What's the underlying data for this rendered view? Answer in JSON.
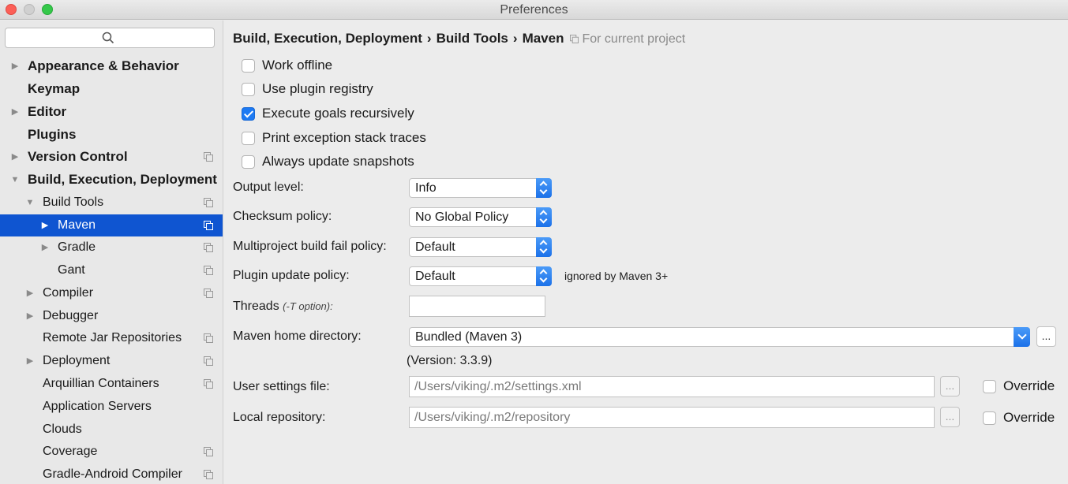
{
  "window": {
    "title": "Preferences"
  },
  "sidebar": {
    "search_placeholder": "",
    "items": [
      {
        "label": "Appearance & Behavior",
        "bold": true,
        "arrow": "right"
      },
      {
        "label": "Keymap",
        "bold": true,
        "arrow": ""
      },
      {
        "label": "Editor",
        "bold": true,
        "arrow": "right"
      },
      {
        "label": "Plugins",
        "bold": true,
        "arrow": ""
      },
      {
        "label": "Version Control",
        "bold": true,
        "arrow": "right"
      },
      {
        "label": "Build, Execution, Deployment",
        "bold": true,
        "arrow": "down"
      },
      {
        "label": "Build Tools",
        "bold": false,
        "arrow": "down"
      },
      {
        "label": "Maven",
        "bold": false,
        "arrow": "right",
        "selected": true
      },
      {
        "label": "Gradle",
        "bold": false,
        "arrow": "right"
      },
      {
        "label": "Gant",
        "bold": false,
        "arrow": ""
      },
      {
        "label": "Compiler",
        "bold": false,
        "arrow": "right"
      },
      {
        "label": "Debugger",
        "bold": false,
        "arrow": "right"
      },
      {
        "label": "Remote Jar Repositories",
        "bold": false,
        "arrow": ""
      },
      {
        "label": "Deployment",
        "bold": false,
        "arrow": "right"
      },
      {
        "label": "Arquillian Containers",
        "bold": false,
        "arrow": ""
      },
      {
        "label": "Application Servers",
        "bold": false,
        "arrow": ""
      },
      {
        "label": "Clouds",
        "bold": false,
        "arrow": ""
      },
      {
        "label": "Coverage",
        "bold": false,
        "arrow": ""
      },
      {
        "label": "Gradle-Android Compiler",
        "bold": false,
        "arrow": ""
      }
    ]
  },
  "breadcrumb": {
    "part1": "Build, Execution, Deployment",
    "part2": "Build Tools",
    "part3": "Maven",
    "separator": "›",
    "note": "For current project"
  },
  "options": {
    "work_offline": {
      "label": "Work offline",
      "checked": false
    },
    "use_plugin_registry": {
      "label": "Use plugin registry",
      "checked": false
    },
    "execute_goals_recursively": {
      "label": "Execute goals recursively",
      "checked": true
    },
    "print_exception_stack_traces": {
      "label": "Print exception stack traces",
      "checked": false
    },
    "always_update_snapshots": {
      "label": "Always update snapshots",
      "checked": false
    }
  },
  "form": {
    "output_level": {
      "label": "Output level:",
      "value": "Info"
    },
    "checksum_policy": {
      "label": "Checksum policy:",
      "value": "No Global Policy"
    },
    "multiproject_fail_policy": {
      "label": "Multiproject build fail policy:",
      "value": "Default"
    },
    "plugin_update_policy": {
      "label": "Plugin update policy:",
      "value": "Default",
      "note": "ignored by Maven 3+"
    },
    "threads": {
      "label": "Threads",
      "hint": "(-T option):",
      "value": ""
    },
    "maven_home": {
      "label": "Maven home directory:",
      "value": "Bundled (Maven 3)",
      "browse": "...",
      "version": "(Version: 3.3.9)"
    },
    "user_settings": {
      "label": "User settings file:",
      "value": "/Users/viking/.m2/settings.xml",
      "browse": "...",
      "override_label": "Override",
      "override_checked": false
    },
    "local_repository": {
      "label": "Local repository:",
      "value": "/Users/viking/.m2/repository",
      "browse": "...",
      "override_label": "Override",
      "override_checked": false
    }
  },
  "colors": {
    "selection": "#0f55d1",
    "accent": "#1d7af3"
  }
}
